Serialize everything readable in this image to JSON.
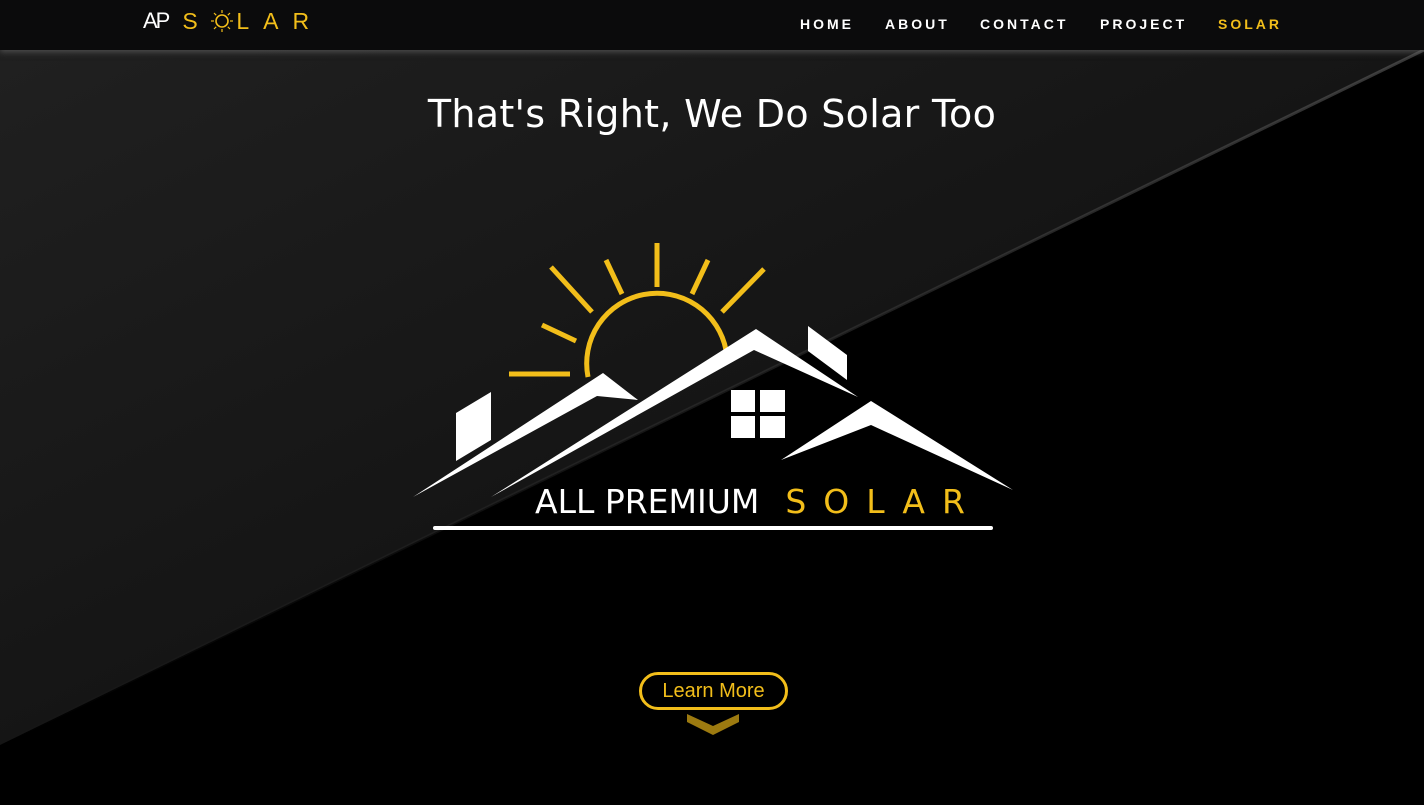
{
  "header": {
    "logo_prefix": "AP",
    "logo_word_s": "S",
    "logo_word_rest": "LAR",
    "nav": [
      {
        "label": "HOME",
        "active": false
      },
      {
        "label": "ABOUT",
        "active": false
      },
      {
        "label": "CONTACT",
        "active": false
      },
      {
        "label": "PROJECT",
        "active": false
      },
      {
        "label": "SOLAR",
        "active": true
      }
    ]
  },
  "hero": {
    "headline": "That's Right, We Do Solar Too",
    "brand_main": "ALL PREMIUM",
    "brand_accent": "SOLAR",
    "cta_label": "Learn More"
  },
  "colors": {
    "accent": "#f2be1a",
    "chevron": "#9c7a10",
    "background": "#000000",
    "text": "#ffffff"
  },
  "icons": {
    "logo_sun": "sun-icon",
    "chevron": "chevron-down-icon",
    "house": "house-roof-logo"
  }
}
